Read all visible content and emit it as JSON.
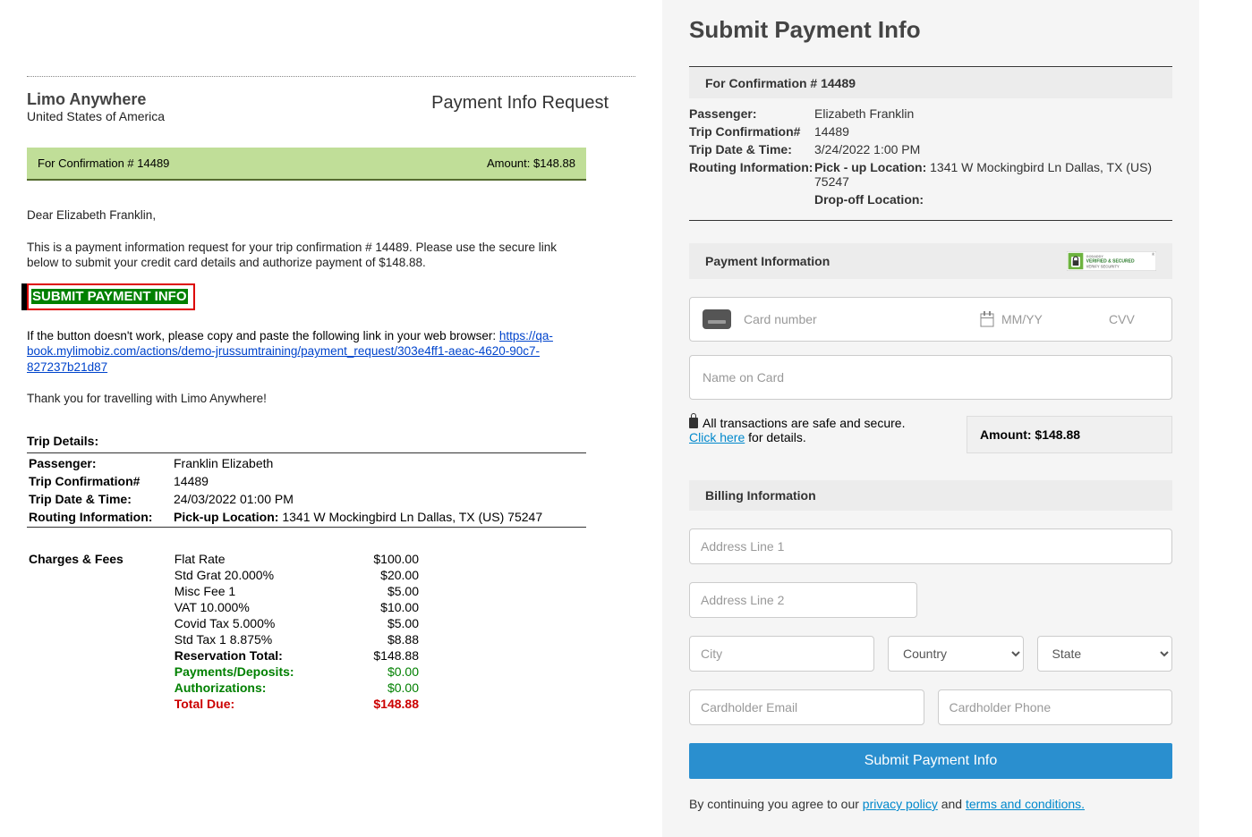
{
  "left": {
    "company": "Limo Anywhere",
    "country": "United States of America",
    "request_title": "Payment Info Request",
    "confirm_text": "For Confirmation # 14489",
    "amount_text": "Amount: $148.88",
    "dear": "Dear Elizabeth Franklin,",
    "body_para": "This is a payment information request for your trip confirmation # 14489. Please use the secure link below to submit your credit card details and authorize payment of $148.88.",
    "submit_label": "SUBMIT PAYMENT INFO",
    "link_intro": "If the button doesn't work, please copy and paste the following link in your web browser: ",
    "link_url": "https://qa-book.mylimobiz.com/actions/demo-jrussumtraining/payment_request/303e4ff1-aeac-4620-90c7-827237b21d87",
    "thank_you": "Thank you for travelling with Limo Anywhere!",
    "details_head": "Trip Details:",
    "details": {
      "passenger_l": "Passenger:",
      "passenger_v": "Franklin Elizabeth",
      "conf_l": "Trip Confirmation#",
      "conf_v": "14489",
      "dt_l": "Trip Date & Time:",
      "dt_v": "24/03/2022 01:00 PM",
      "route_l": "Routing Information:",
      "route_k": "Pick-up Location:",
      "route_v": " 1341 W Mockingbird Ln Dallas, TX (US) 75247"
    },
    "charges_head": "Charges & Fees",
    "charges": [
      {
        "desc": "Flat Rate",
        "val": "$100.00"
      },
      {
        "desc": "Std Grat 20.000%",
        "val": "$20.00"
      },
      {
        "desc": "Misc Fee 1",
        "val": "$5.00"
      },
      {
        "desc": "VAT 10.000%",
        "val": "$10.00"
      },
      {
        "desc": "Covid Tax 5.000%",
        "val": "$5.00"
      },
      {
        "desc": "Std Tax 1 8.875%",
        "val": "$8.88"
      }
    ],
    "totals": {
      "res_l": "Reservation Total:",
      "res_v": "$148.88",
      "pay_l": "Payments/Deposits:",
      "pay_v": "$0.00",
      "auth_l": "Authorizations:",
      "auth_v": "$0.00",
      "due_l": "Total Due:",
      "due_v": "$148.88"
    }
  },
  "right": {
    "title": "Submit Payment Info",
    "confirm_bar": "For Confirmation # 14489",
    "passenger_l": "Passenger:",
    "passenger_v": "Elizabeth Franklin",
    "conf_l": "Trip Confirmation#",
    "conf_v": "14489",
    "dt_l": "Trip Date & Time:",
    "dt_v": "3/24/2022 1:00 PM",
    "route_l": "Routing Information:",
    "pickup_l": "Pick - up Location:",
    "pickup_v": " 1341 W Mockingbird Ln Dallas, TX (US) 75247",
    "dropoff_l": "Drop-off Location:",
    "pay_info_head": "Payment Information",
    "badge_top": "GODADDY",
    "badge_main": "VERIFIED & SECURED",
    "badge_sub": "VERIFY SECURITY",
    "card_ph": "Card number",
    "expiry_ph": "MM/YY",
    "cvv_ph": "CVV",
    "name_ph": "Name on Card",
    "secure_text": "All transactions are safe and secure.",
    "click_here": "Click here",
    "for_details": " for details.",
    "amount_label": "Amount: $148.88",
    "billing_head": "Billing Information",
    "addr1_ph": "Address Line 1",
    "addr2_ph": "Address Line 2",
    "city_ph": "City",
    "country_ph": "Country",
    "state_ph": "State",
    "email_ph": "Cardholder Email",
    "phone_ph": "Cardholder Phone",
    "submit_btn": "Submit Payment Info",
    "terms_intro": "By continuing you agree to our ",
    "privacy": "privacy policy",
    "and": " and ",
    "terms": "terms and conditions."
  }
}
